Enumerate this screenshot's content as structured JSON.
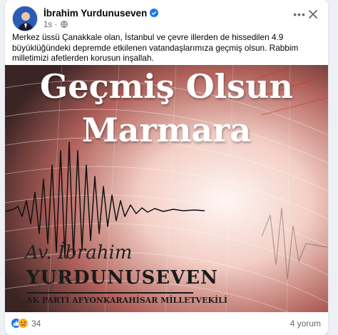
{
  "post": {
    "author": "İbrahim Yurdunuseven",
    "time": "1s",
    "separator": "·",
    "more_label": "•••",
    "close_label": "✕",
    "text": "Merkez üssü Çanakkale olan, İstanbul ve çevre illerden de hissedilen 4.9 büyüklüğündeki depremde etkilenen vatandaşlarımıza geçmiş olsun. Rabbim milletimizi afetlerden korusun inşallah.",
    "icons": {
      "verified": "verified-badge-icon",
      "audience": "globe-icon",
      "more": "more-options-icon",
      "close": "close-icon"
    }
  },
  "image": {
    "headline_line1": "Geçmiş Olsun",
    "headline_line2": "Marmara",
    "signature_script": "Av. İbrahim",
    "signature_name": "YURDUNUSEVEN",
    "signature_title": "AK PARTİ AFYONKARAHİSAR MİLLETVEKİLİ"
  },
  "footer": {
    "reaction_icons": [
      "like-icon",
      "sad-icon"
    ],
    "reaction_count": "34",
    "comments": "4 yorum"
  },
  "colors": {
    "accent": "#1877f2",
    "text": "#050505",
    "muted": "#65676b",
    "background": "#eef0f4",
    "card": "#ffffff",
    "seismo_red": "#c0392b"
  }
}
